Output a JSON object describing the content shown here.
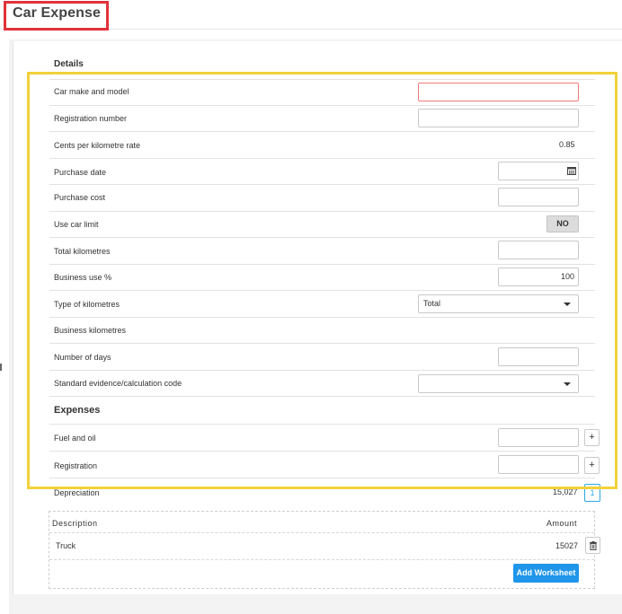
{
  "page": {
    "title": "Car Expense"
  },
  "details": {
    "heading": "Details",
    "rows": {
      "car_make": {
        "label": "Car make and model",
        "value": ""
      },
      "registration_number": {
        "label": "Registration number",
        "value": ""
      },
      "cents_rate": {
        "label": "Cents per kilometre rate",
        "value": "0.85"
      },
      "purchase_date": {
        "label": "Purchase date",
        "value": ""
      },
      "purchase_cost": {
        "label": "Purchase cost",
        "value": ""
      },
      "use_car_limit": {
        "label": "Use car limit",
        "value": "NO"
      },
      "total_km": {
        "label": "Total kilometres",
        "value": ""
      },
      "business_use": {
        "label": "Business use %",
        "value": "100"
      },
      "type_km": {
        "label": "Type of kilometres",
        "value": "Total"
      },
      "business_km": {
        "label": "Business kilometres",
        "value": ""
      },
      "number_days": {
        "label": "Number of days",
        "value": ""
      },
      "standard_code": {
        "label": "Standard evidence/calculation code",
        "value": ""
      }
    }
  },
  "expenses": {
    "heading": "Expenses",
    "rows": {
      "fuel": {
        "label": "Fuel and oil",
        "value": "",
        "button": "+"
      },
      "registration": {
        "label": "Registration",
        "value": "",
        "button": "+"
      },
      "depreciation": {
        "label": "Depreciation",
        "value": "15,027",
        "button": "1"
      }
    }
  },
  "worksheet": {
    "col_description": "Description",
    "col_amount": "Amount",
    "rows": [
      {
        "description": "Truck",
        "amount": "15027"
      }
    ],
    "add_label": "Add Worksheet"
  },
  "icons": {
    "calendar": "calendar-icon",
    "trash": "trash-icon",
    "dropdown": "chevron-down-icon"
  },
  "colors": {
    "title_highlight": "#e0333b",
    "selection_highlight": "#f2d13a",
    "primary_button": "#1f96ea",
    "invalid_border": "#ef7a7a"
  }
}
